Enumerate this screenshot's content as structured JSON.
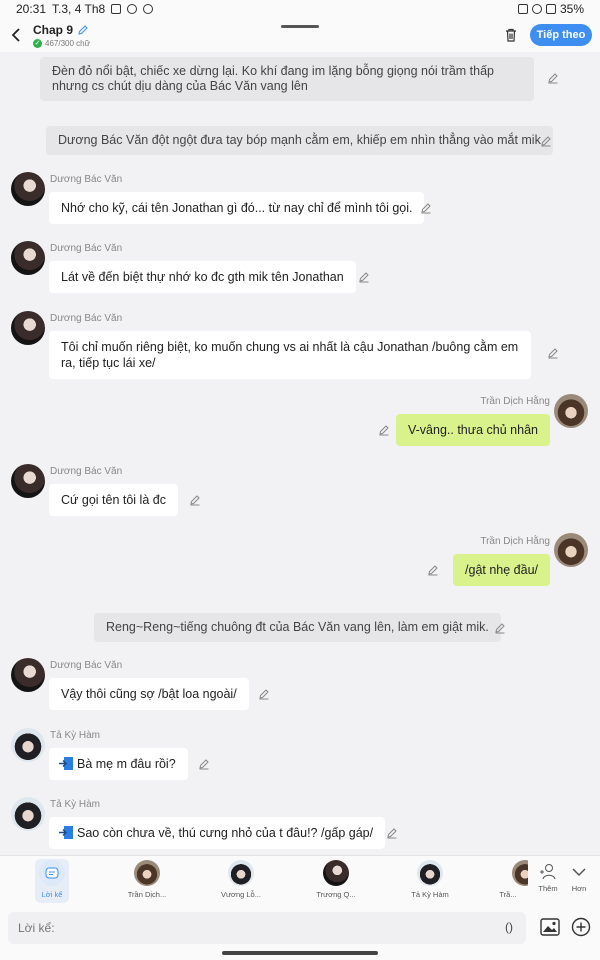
{
  "status": {
    "time": "20:31",
    "date": "T.3, 4 Th8",
    "battery": "35%"
  },
  "header": {
    "title": "Chap 9",
    "word_count": "467/300 chữ",
    "next_label": "Tiếp theo"
  },
  "messages": [
    {
      "kind": "narr",
      "text": "Đèn đỏ nổi bật, chiếc xe dừng lại. Ko khí đang im lặng bỗng giọng nói trầm thấp nhưng cs chút dịu dàng của Bác Văn vang lên"
    },
    {
      "kind": "narr",
      "text": "Dương Bác Văn đột ngột đưa tay bóp mạnh cằm em, khiếp em nhìn thẳng vào mắt mik"
    },
    {
      "kind": "left",
      "name": "Dương Bác Văn",
      "text": "Nhớ cho kỹ, cái tên Jonathan gì đó... từ nay chỉ để mình tôi gọi."
    },
    {
      "kind": "left",
      "name": "Dương Bác Văn",
      "text": "Lát về đến biệt thự nhớ ko đc gth mik tên Jonathan"
    },
    {
      "kind": "left",
      "name": "Dương Bác Văn",
      "text": "Tôi chỉ muốn riêng biệt, ko muốn chung vs ai nhất là cậu Jonathan /buông cằm em ra, tiếp tục lái xe/"
    },
    {
      "kind": "right",
      "name": "Trần Dịch Hằng",
      "text": "V-vâng.. thưa chủ nhân"
    },
    {
      "kind": "left",
      "name": "Dương Bác Văn",
      "text": "Cứ gọi tên tôi là đc"
    },
    {
      "kind": "right",
      "name": "Trần Dịch Hằng",
      "text": "/gật nhẹ đầu/"
    },
    {
      "kind": "narr",
      "text": "Reng~Reng~tiếng chuông đt của Bác Văn vang lên, làm em giật mik."
    },
    {
      "kind": "left",
      "name": "Dương Bác Văn",
      "text": "Vậy thôi cũng sợ /bật loa ngoài/"
    },
    {
      "kind": "left",
      "name": "Tả Kỳ Hàm",
      "text": "Bà mẹ m đâu rồi?"
    },
    {
      "kind": "left",
      "name": "Tả Kỳ Hàm",
      "text": "Sao còn chưa về, thú cưng nhỏ của t đâu!? /gấp gáp/"
    }
  ],
  "characters": [
    {
      "label": "Lời kể"
    },
    {
      "label": "Trần Dịch..."
    },
    {
      "label": "Vương Lỗ..."
    },
    {
      "label": "Trương Q..."
    },
    {
      "label": "Tả Kỳ Hàm"
    },
    {
      "label": "Trầ..."
    }
  ],
  "more_actions": {
    "add": "Thêm",
    "more": "Hơn"
  },
  "input": {
    "placeholder": "Lời kể:",
    "paren": "()"
  },
  "colors": {
    "accent": "#3d8ef0",
    "my_bubble": "#d9f28c",
    "narration_bg": "#e6e6e8"
  }
}
